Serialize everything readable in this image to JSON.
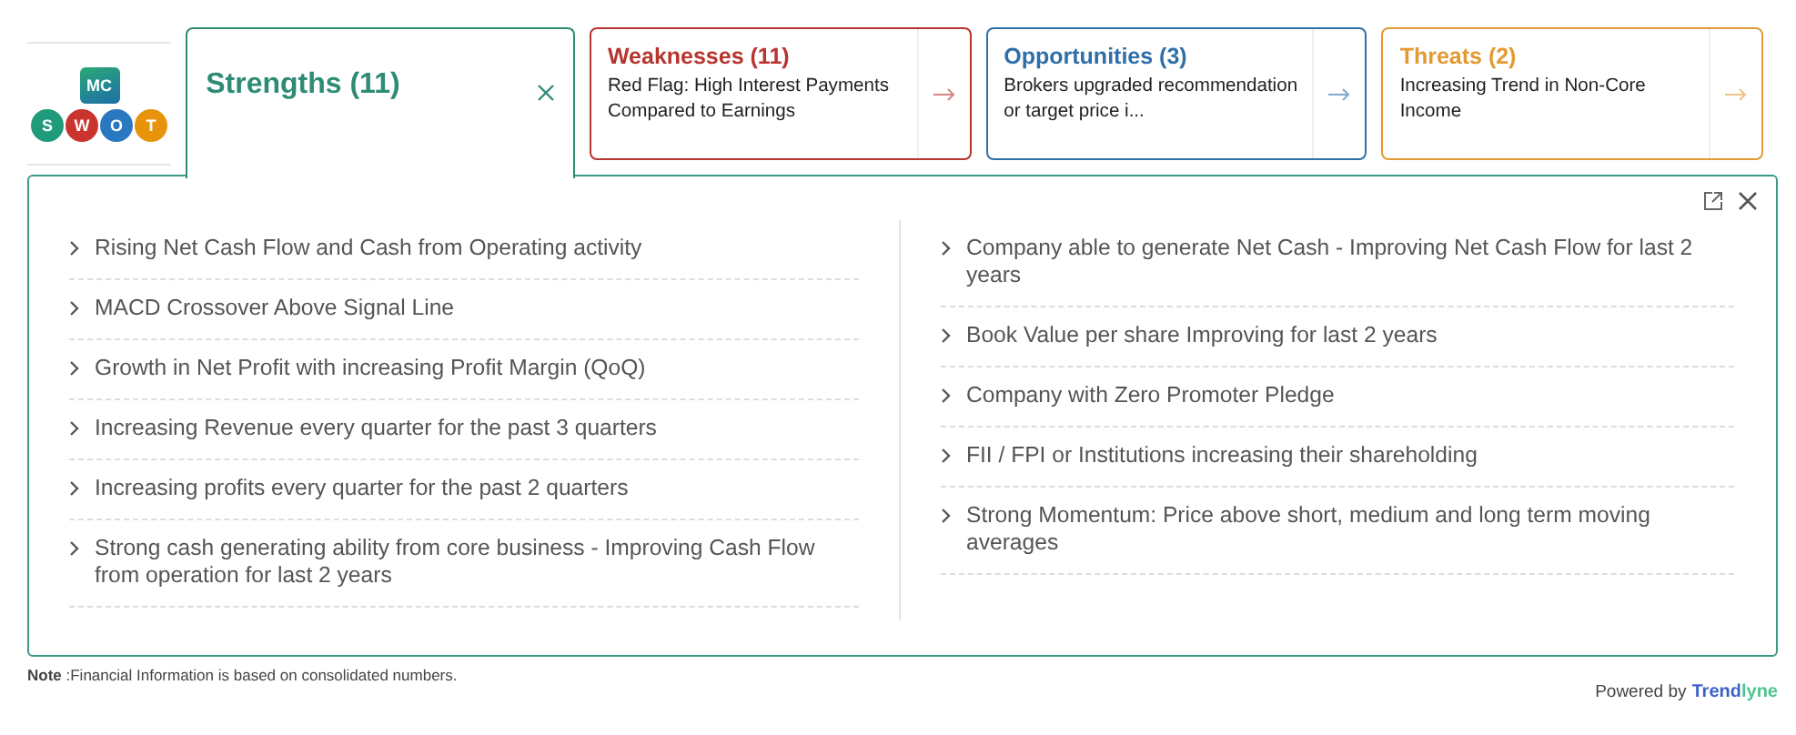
{
  "logo": {
    "badge": "MC",
    "letters": [
      {
        "text": "S",
        "color": "#1f9a7a"
      },
      {
        "text": "W",
        "color": "#c9342e"
      },
      {
        "text": "O",
        "color": "#2a78c2"
      },
      {
        "text": "T",
        "color": "#e8930c"
      }
    ]
  },
  "tabs": [
    {
      "title": "Strengths (11)",
      "color": "#2e8b74",
      "selected": true
    },
    {
      "title": "Weaknesses (11)",
      "summary": "Red Flag: High Interest Payments Compared to Earnings",
      "color": "#b8342f",
      "selected": false
    },
    {
      "title": "Opportunities (3)",
      "summary": "Brokers upgraded recommendation or target price i...",
      "color": "#2f6fa8",
      "selected": false
    },
    {
      "title": "Threats (2)",
      "summary": "Increasing Trend in Non-Core Income",
      "color": "#e39a33",
      "selected": false
    }
  ],
  "items_left": [
    "Rising Net Cash Flow and Cash from Operating activity",
    "MACD Crossover Above Signal Line",
    "Growth in Net Profit with increasing Profit Margin (QoQ)",
    "Increasing Revenue every quarter for the past 3 quarters",
    "Increasing profits every quarter for the past 2 quarters",
    "Strong cash generating ability from core business - Improving Cash Flow from operation for last 2 years"
  ],
  "items_right": [
    "Company able to generate Net Cash - Improving Net Cash Flow for last 2 years",
    "Book Value per share Improving for last 2 years",
    "Company with Zero Promoter Pledge",
    "FII / FPI or Institutions increasing their shareholding",
    "Strong Momentum: Price above short, medium and long term moving averages"
  ],
  "note": "**Note** :Financial Information is based on consolidated numbers.",
  "powered_by": "Powered by",
  "brand": "Trendlyne"
}
